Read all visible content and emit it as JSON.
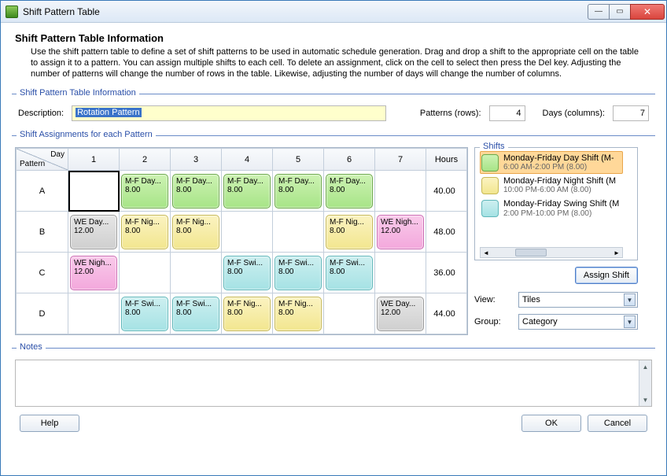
{
  "window": {
    "title": "Shift Pattern Table"
  },
  "header": {
    "heading": "Shift Pattern Table Information",
    "intro": "Use the shift pattern table to define a set of shift patterns to be used in automatic schedule generation. Drag and drop a shift to the appropriate cell on the table to assign it to a pattern. You can assign multiple shifts to each cell. To delete an assignment, click on the cell to select then press the Del key.  Adjusting the number of patterns will change the number of rows in the table. Likewise, adjusting the number of days will change the number of columns."
  },
  "info": {
    "legend": "Shift Pattern Table Information",
    "description_label": "Description:",
    "description_value": "Rotation Pattern",
    "patterns_label": "Patterns (rows):",
    "patterns_value": "4",
    "days_label": "Days (columns):",
    "days_value": "7"
  },
  "assignments": {
    "legend": "Shift Assignments for each Pattern",
    "corner": {
      "day": "Day",
      "pattern": "Pattern"
    },
    "day_headers": [
      "1",
      "2",
      "3",
      "4",
      "5",
      "6",
      "7"
    ],
    "hours_header": "Hours",
    "rows": [
      {
        "label": "A",
        "hours": "40.00",
        "cells": [
          null,
          {
            "t": "M-F Day...",
            "h": "8.00",
            "c": "green"
          },
          {
            "t": "M-F Day...",
            "h": "8.00",
            "c": "green"
          },
          {
            "t": "M-F Day...",
            "h": "8.00",
            "c": "green"
          },
          {
            "t": "M-F Day...",
            "h": "8.00",
            "c": "green"
          },
          {
            "t": "M-F Day...",
            "h": "8.00",
            "c": "green"
          },
          null
        ]
      },
      {
        "label": "B",
        "hours": "48.00",
        "cells": [
          {
            "t": "WE Day...",
            "h": "12.00",
            "c": "grey"
          },
          {
            "t": "M-F Nig...",
            "h": "8.00",
            "c": "yellow"
          },
          {
            "t": "M-F Nig...",
            "h": "8.00",
            "c": "yellow"
          },
          null,
          null,
          {
            "t": "M-F Nig...",
            "h": "8.00",
            "c": "yellow"
          },
          {
            "t": "WE Nigh...",
            "h": "12.00",
            "c": "pink"
          }
        ]
      },
      {
        "label": "C",
        "hours": "36.00",
        "cells": [
          {
            "t": "WE Nigh...",
            "h": "12.00",
            "c": "pink"
          },
          null,
          null,
          {
            "t": "M-F Swi...",
            "h": "8.00",
            "c": "cyan"
          },
          {
            "t": "M-F Swi...",
            "h": "8.00",
            "c": "cyan"
          },
          {
            "t": "M-F Swi...",
            "h": "8.00",
            "c": "cyan"
          },
          null
        ]
      },
      {
        "label": "D",
        "hours": "44.00",
        "cells": [
          null,
          {
            "t": "M-F Swi...",
            "h": "8.00",
            "c": "cyan"
          },
          {
            "t": "M-F Swi...",
            "h": "8.00",
            "c": "cyan"
          },
          {
            "t": "M-F Nig...",
            "h": "8.00",
            "c": "yellow"
          },
          {
            "t": "M-F Nig...",
            "h": "8.00",
            "c": "yellow"
          },
          null,
          {
            "t": "WE Day...",
            "h": "12.00",
            "c": "grey"
          }
        ]
      }
    ]
  },
  "shifts_panel": {
    "legend": "Shifts",
    "items": [
      {
        "title": "Monday-Friday Day Shift (M-",
        "sub": "6:00 AM-2:00 PM (8.00)",
        "swatch": "green",
        "selected": true
      },
      {
        "title": "Monday-Friday Night Shift (M",
        "sub": "10:00 PM-6:00 AM (8.00)",
        "swatch": "yellow",
        "selected": false
      },
      {
        "title": "Monday-Friday Swing Shift (M",
        "sub": "2:00 PM-10:00 PM (8.00)",
        "swatch": "cyan",
        "selected": false
      }
    ],
    "assign_label": "Assign Shift",
    "view_label": "View:",
    "view_value": "Tiles",
    "group_label": "Group:",
    "group_value": "Category"
  },
  "notes": {
    "legend": "Notes",
    "value": ""
  },
  "buttons": {
    "help": "Help",
    "ok": "OK",
    "cancel": "Cancel"
  },
  "colors": {
    "green": "#a7e487",
    "yellow": "#f2e68f",
    "cyan": "#a5e2e4",
    "grey": "#cfcfcf",
    "pink": "#f3a8dc"
  }
}
